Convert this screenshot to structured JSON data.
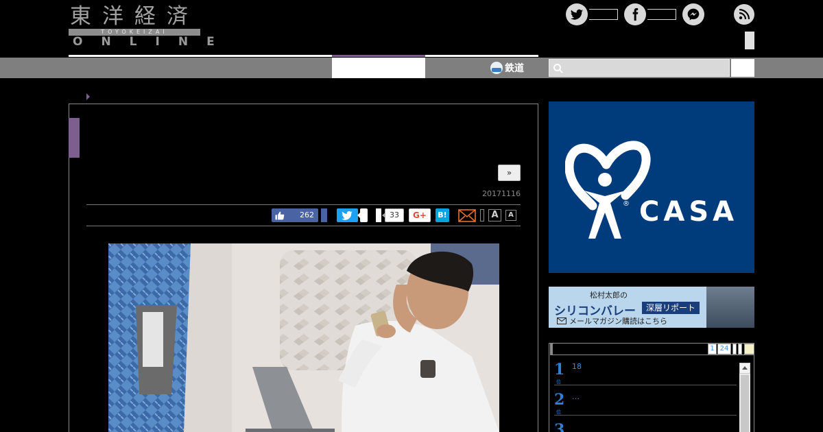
{
  "header": {
    "logo_kanji": "東洋経済",
    "logo_sub": "TOYOKEIZAI",
    "logo_online": "ONLINE"
  },
  "social": [
    {
      "name": "twitter-icon",
      "color": "#d8d8d8"
    },
    {
      "name": "facebook-icon",
      "color": "#d8d8d8"
    },
    {
      "name": "messenger-icon",
      "color": "#d8d8d8"
    },
    {
      "name": "rss-icon",
      "color": "#d8d8d8"
    }
  ],
  "nav": {
    "rail_label": "鉄道",
    "search_placeholder": ""
  },
  "article": {
    "next_label": "»",
    "date": "20171116",
    "share": {
      "like_count": "262",
      "pocket_count": "33",
      "gplus_label": "G+",
      "hatena_label": "B!",
      "font_large": "A",
      "font_small": "A"
    }
  },
  "ads": {
    "casa_text": "CASA",
    "casa_reg": "®",
    "casa_bg": "#003b7c",
    "banner": {
      "author": "松村太郎の",
      "title": "シリコンバレー",
      "tag": "深層リポート",
      "mail": "メールマガジン購読はこちら"
    }
  },
  "ranking": {
    "tabs": [
      "1",
      "24"
    ],
    "items": [
      {
        "rank": "1",
        "unit": "位",
        "text": "18"
      },
      {
        "rank": "2",
        "unit": "位",
        "text": "…"
      },
      {
        "rank": "3",
        "unit": "位",
        "text": ""
      }
    ],
    "accent": "#2e7fd6"
  }
}
